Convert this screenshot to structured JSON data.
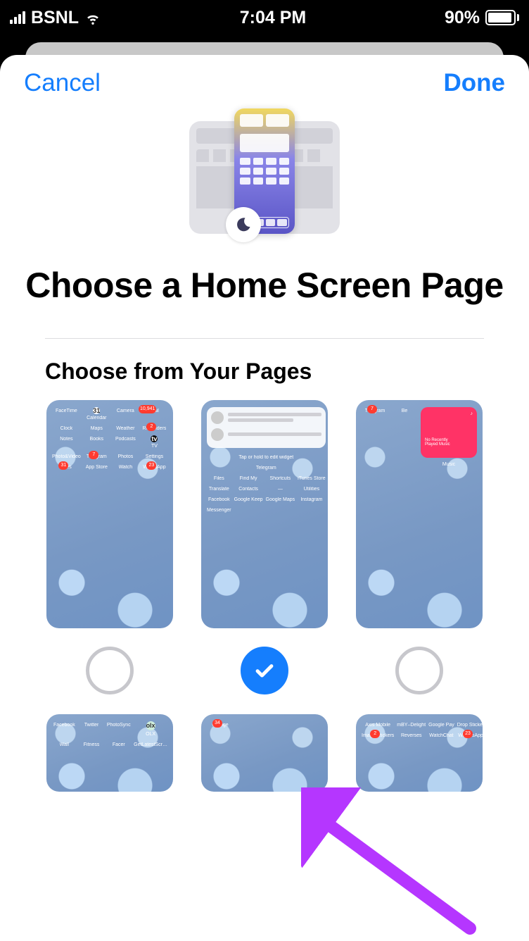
{
  "statusbar": {
    "carrier": "BSNL",
    "time": "7:04 PM",
    "battery_pct": "90%"
  },
  "nav": {
    "cancel": "Cancel",
    "done": "Done"
  },
  "title": "Choose a Home Screen Page",
  "subtitle": "Choose from Your Pages",
  "widget_hint": "Tap or hold to edit widget",
  "widget_name": "Telegram",
  "music_widget": {
    "line1": "No Recently",
    "line2": "Played Music",
    "label": "Music"
  },
  "pages": [
    {
      "selected": false,
      "row_count": 5,
      "apps": [
        {
          "label": "FaceTime",
          "color": "#34c759"
        },
        {
          "label": "Calendar",
          "color": "#ffffff",
          "text": "31"
        },
        {
          "label": "Camera",
          "color": "#3a3a3c"
        },
        {
          "label": "Mail",
          "color": "#1d9bf6",
          "badge": "10,941"
        },
        {
          "label": "Clock",
          "color": "#111"
        },
        {
          "label": "Maps",
          "color": "#6fe07a"
        },
        {
          "label": "Weather",
          "color": "#2e9cf4"
        },
        {
          "label": "Reminders",
          "color": "#ffffff",
          "badge": "2"
        },
        {
          "label": "Notes",
          "color": "#f7e08c"
        },
        {
          "label": "Books",
          "color": "#ff7a00"
        },
        {
          "label": "Podcasts",
          "color": "#a951e8"
        },
        {
          "label": "TV",
          "color": "#111",
          "text": "tv"
        },
        {
          "label": "Photo&Video",
          "color": "#2d2d2d"
        },
        {
          "label": "Telegram",
          "color": "#2ba7e6",
          "badge": "7"
        },
        {
          "label": "Photos",
          "color": "#fff"
        },
        {
          "label": "Settings",
          "color": "#8e8e93"
        },
        {
          "label": "Files",
          "color": "#3d9ef7",
          "badge": "31"
        },
        {
          "label": "App Store",
          "color": "#1e90ff"
        },
        {
          "label": "Watch",
          "color": "#111"
        },
        {
          "label": "WhatsApp",
          "color": "#25d366",
          "badge": "23"
        }
      ]
    },
    {
      "selected": true,
      "has_widget": true,
      "apps": [
        {
          "label": "Files",
          "color": "#3d9ef7"
        },
        {
          "label": "Find My",
          "color": "#f2f2f7"
        },
        {
          "label": "Shortcuts",
          "color": "#4f55d6"
        },
        {
          "label": "iTunes Store",
          "color": "#f73ba0"
        },
        {
          "label": "Translate",
          "color": "#222"
        },
        {
          "label": "Contacts",
          "color": "#d0d0d5"
        },
        {
          "label": "—",
          "color": "#fff"
        },
        {
          "label": "Utilities",
          "color": "#fff"
        },
        {
          "label": "Facebook",
          "color": "#1877f2"
        },
        {
          "label": "Google Keep",
          "color": "#fbbc04"
        },
        {
          "label": "Google Maps",
          "color": "#fff"
        },
        {
          "label": "Instagram",
          "color": "#d83ec8"
        },
        {
          "label": "Messenger",
          "color": "#7b3ff2"
        }
      ]
    },
    {
      "selected": false,
      "layout": "sparse",
      "apps": [
        {
          "label": "Telegram",
          "color": "#2ba7e6",
          "badge": "7"
        },
        {
          "label": "Be",
          "color": "#f04e50"
        }
      ]
    },
    {
      "selected": false,
      "row_count": 2,
      "apps": [
        {
          "label": "Facebook",
          "color": "#1877f2"
        },
        {
          "label": "Twitter",
          "color": "#1da1f2"
        },
        {
          "label": "PhotoSync",
          "color": "#111"
        },
        {
          "label": "OLX",
          "color": "#cfeedd",
          "text": "olx"
        },
        {
          "label": "Wall",
          "color": "#46c0b8"
        },
        {
          "label": "Fitness",
          "color": "#111"
        },
        {
          "label": "Facer",
          "color": "#fff"
        },
        {
          "label": "GetLatestScr…",
          "color": "#4aa3f0"
        }
      ]
    },
    {
      "selected": false,
      "row_count": 1,
      "apps": [
        {
          "label": "Orange",
          "color": "#ff6a2b",
          "badge": "34"
        }
      ]
    },
    {
      "selected": false,
      "row_count": 2,
      "apps": [
        {
          "label": "Axis Mobile",
          "color": "#9a1b4e"
        },
        {
          "label": "mBY–Delight",
          "color": "#fff"
        },
        {
          "label": "Google Pay",
          "color": "#fff"
        },
        {
          "label": "Drop Sticker",
          "color": "#fff"
        },
        {
          "label": "Image Stickers",
          "color": "#d6336c",
          "badge": "2"
        },
        {
          "label": "Reverses",
          "color": "#fff"
        },
        {
          "label": "WatchChat",
          "color": "#25d366"
        },
        {
          "label": "WatchsApp",
          "color": "#111",
          "badge": "23"
        }
      ]
    }
  ]
}
